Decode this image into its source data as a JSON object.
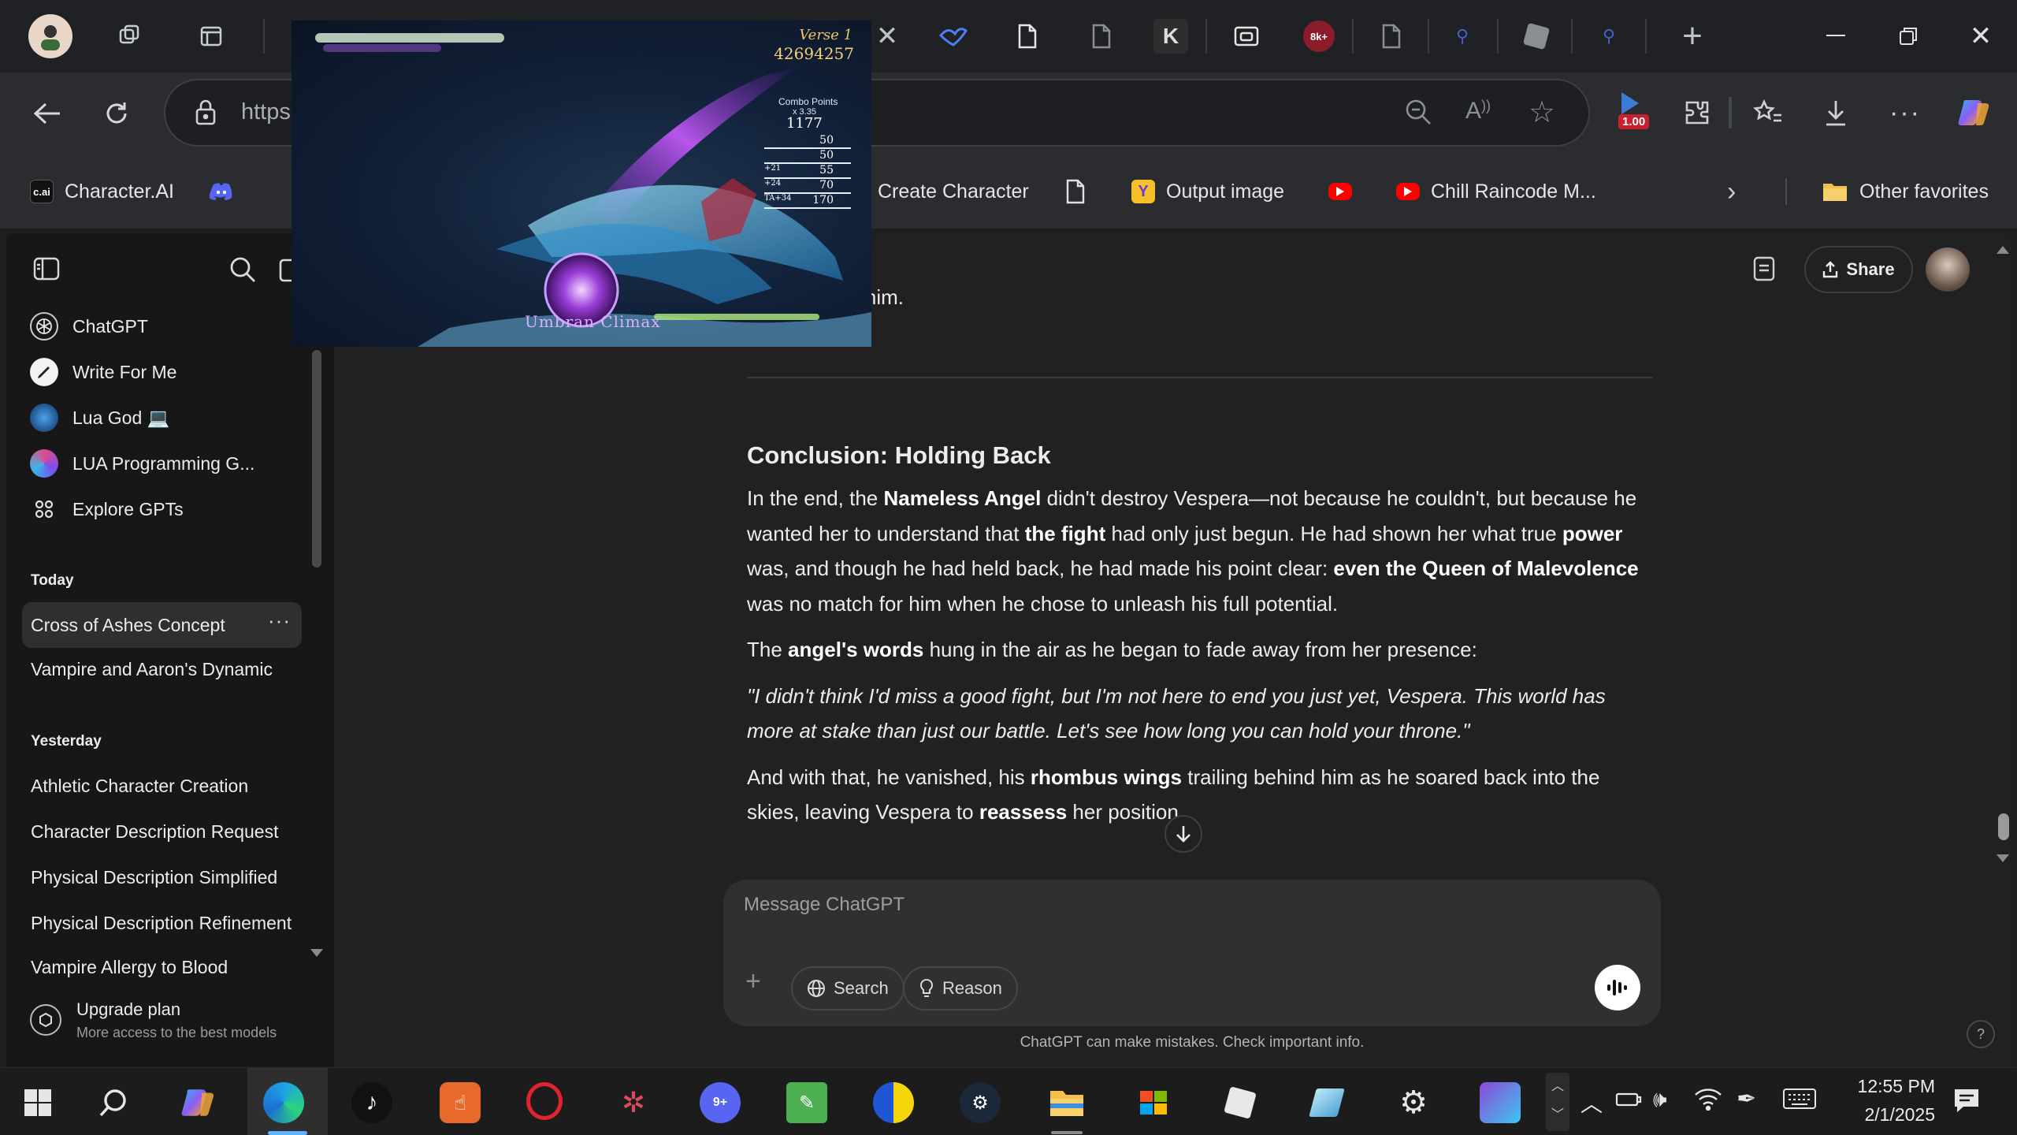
{
  "browser": {
    "url_prefix": "https",
    "tab_badge": "8k+",
    "zoom_badge": "1.00"
  },
  "favorites": [
    {
      "label": "Character.AI",
      "icon": "c.ai"
    },
    {
      "label": "Create Character"
    },
    {
      "label": "Output image"
    },
    {
      "label": "Chill Raincode M..."
    }
  ],
  "favorites_other": "Other favorites",
  "sidebar": {
    "gpts": [
      {
        "label": "ChatGPT"
      },
      {
        "label": "Write For Me"
      },
      {
        "label": "Lua God 💻"
      },
      {
        "label": "LUA Programming G..."
      },
      {
        "label": "Explore GPTs"
      }
    ],
    "today_heading": "Today",
    "today": [
      "Cross of Ashes Concept",
      "Vampire and Aaron's Dynamic"
    ],
    "yesterday_heading": "Yesterday",
    "yesterday": [
      "Athletic Character Creation",
      "Character Description Request",
      "Physical Description Simplified",
      "Physical Description Refinement",
      "Vampire Allergy to Blood"
    ],
    "upgrade_title": "Upgrade plan",
    "upgrade_sub": "More access to the best models"
  },
  "header": {
    "share_label": "Share"
  },
  "article": {
    "partial_line": "cut him.",
    "heading": "Conclusion: Holding Back",
    "p1": [
      {
        "t": "In the end, the "
      },
      {
        "t": "Nameless Angel",
        "b": true
      },
      {
        "t": " didn't destroy Vespera—not because he couldn't, but because he wanted her to understand that "
      },
      {
        "t": "the fight",
        "b": true
      },
      {
        "t": " had only just begun. He had shown her what true "
      },
      {
        "t": "power",
        "b": true
      },
      {
        "t": " was, and though he had held back, he had made his point clear: "
      },
      {
        "t": "even the Queen of Malevolence",
        "b": true
      },
      {
        "t": " was no match for him when he chose to unleash his full potential."
      }
    ],
    "p2": [
      {
        "t": "The "
      },
      {
        "t": "angel's words",
        "b": true
      },
      {
        "t": " hung in the air as he began to fade away from her presence:"
      }
    ],
    "quote": "\"I didn't think I'd miss a good fight, but I'm not here to end you just yet, Vespera. This world has more at stake than just our battle. Let's see how long you can hold your throne.\"",
    "p3": [
      {
        "t": "And with that, he vanished, his "
      },
      {
        "t": "rhombus wings",
        "b": true
      },
      {
        "t": " trailing behind him as he soared back into the skies, leaving Vespera to "
      },
      {
        "t": "reassess",
        "b": true
      },
      {
        "t": " her position."
      }
    ]
  },
  "composer": {
    "placeholder": "Message ChatGPT",
    "search_label": "Search",
    "reason_label": "Reason",
    "disclaimer": "ChatGPT can make mistakes. Check important info.",
    "help": "?"
  },
  "pip_game": {
    "verse": "Verse 1",
    "score": "42694257",
    "combo_title": "Combo Points",
    "combo_sub": "x 3.35",
    "combo_value": "1177",
    "rows": [
      "50",
      "50",
      "55",
      "70",
      "170"
    ],
    "row_prefixes": [
      "",
      "",
      "+21",
      "+24",
      "TA+34"
    ],
    "climax": "Umbran Climax"
  },
  "taskbar": {
    "time": "12:55 PM",
    "date": "2/1/2025"
  },
  "colors": {
    "sidebar_bg": "#171717",
    "main_bg": "#212121",
    "composer_bg": "#303030"
  }
}
